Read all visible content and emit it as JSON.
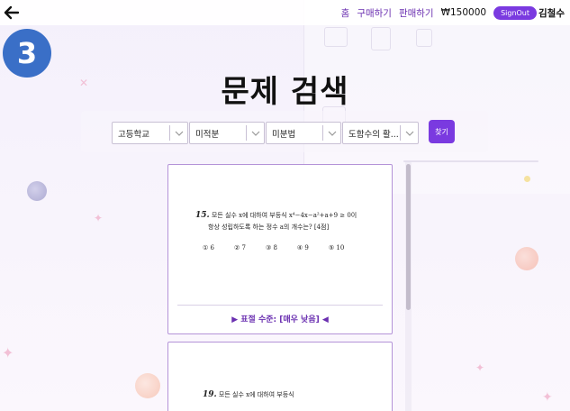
{
  "nav": {
    "home": "홈",
    "buy": "구매하기",
    "sell": "판매하기",
    "balance": "₩150000",
    "signout": "SignOut",
    "user": "김철수"
  },
  "step_badge": "3",
  "page_title": "문제 검색",
  "filters": {
    "school": "고등학교",
    "subject": "미적분",
    "unit": "미분법",
    "topic": "도함수의 활..."
  },
  "search_button": "찾기",
  "problems": [
    {
      "number": "15.",
      "text_line1": "모든 실수 x에 대하여 부등식 x⁴−4x−a²+a+9 ≥ 0이",
      "text_line2": "항상 성립하도록 하는 정수 a의 개수는? [4점]",
      "choices": [
        "① 6",
        "② 7",
        "③ 8",
        "④ 9",
        "⑤ 10"
      ],
      "plagiarism": "▶ 표절 수준: [매우 낮음] ◀"
    },
    {
      "number": "19.",
      "text_line1": "모든 실수 x에 대하여 부등식"
    }
  ],
  "icons": {
    "back": "arrow-left-icon",
    "chevron": "chevron-down-icon"
  },
  "colors": {
    "accent": "#7a3ae0",
    "badge": "#3a6fc7",
    "card_border": "#b493d8"
  }
}
